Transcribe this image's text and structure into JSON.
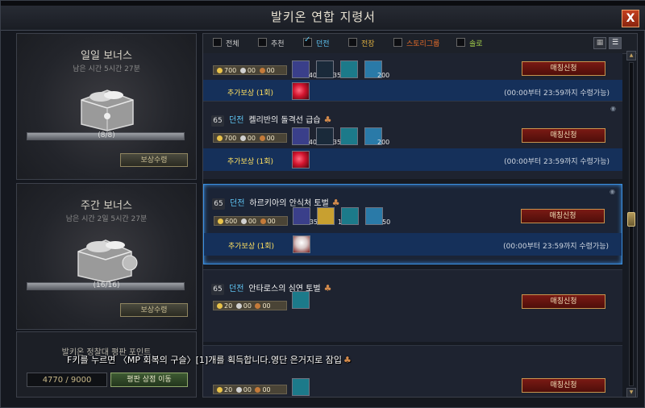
{
  "window": {
    "title": "발키온 연합 지령서",
    "close_label": "X"
  },
  "daily_bonus": {
    "title": "일일 보너스",
    "time_left": "남은 시간 5시간 27분",
    "progress_text": "(8/8)",
    "progress_fraction": 1.0,
    "button": "보상수령"
  },
  "weekly_bonus": {
    "title": "주간 보너스",
    "time_left": "남은 시간 2일 5시간 27분",
    "progress_text": "(16/16)",
    "progress_fraction": 1.0,
    "button": "보상수령"
  },
  "reputation": {
    "title": "발키온 정찰대 평판 포인트",
    "points": "4770 / 9000",
    "shop_button": "평판 상점 이동"
  },
  "filters": [
    {
      "label": "전체",
      "checked": false,
      "color": "#cfcfcf"
    },
    {
      "label": "추천",
      "checked": false,
      "color": "#cfcfcf"
    },
    {
      "label": "던전",
      "checked": true,
      "color": "#5ec4f2"
    },
    {
      "label": "전장",
      "checked": false,
      "color": "#e0b040"
    },
    {
      "label": "스토리그룹",
      "checked": false,
      "color": "#e06a2a"
    },
    {
      "label": "솔로",
      "checked": false,
      "color": "#a4d04a"
    }
  ],
  "cost_top": {
    "gold": "700",
    "silver": "00",
    "copper": "00"
  },
  "quests": [
    {
      "level": "65",
      "category": "던전",
      "name": "켈리반의 돌격선 급습",
      "gold": "700",
      "silver": "00",
      "copper": "00",
      "items": [
        "40",
        "35",
        "",
        "200"
      ],
      "apply": "매칭신청",
      "extra_label": "추가보상 (1회)",
      "extra_time": "(00:00부터 23:59까지 수령가능)",
      "selected": false
    },
    {
      "level": "65",
      "category": "던전",
      "name": "하르키아의 안식처 토벌",
      "gold": "600",
      "silver": "00",
      "copper": "00",
      "items": [
        "35",
        "1",
        "",
        "50"
      ],
      "apply": "매칭신청",
      "extra_label": "추가보상 (1회)",
      "extra_time": "(00:00부터 23:59까지 수령가능)",
      "selected": true
    },
    {
      "level": "65",
      "category": "던전",
      "name": "안타로스의 심연 토벌",
      "gold": "20",
      "silver": "00",
      "copper": "00",
      "items": [
        ""
      ],
      "apply": "매칭신청",
      "selected": false
    },
    {
      "gold": "20",
      "silver": "00",
      "copper": "00",
      "items": [
        ""
      ],
      "apply": "매칭신청",
      "selected": false
    }
  ],
  "top_partial": {
    "items": [
      "40",
      "35",
      "",
      "200"
    ],
    "apply": "매칭신청",
    "extra_label": "추가보상 (1회)",
    "extra_time": "(00:00부터 23:59까지 수령가능)"
  },
  "tooltip": "F키를 누르면 〈MP 회복의 구슬〉[1]개를 획득합니다.영단 은거지로 잠입"
}
